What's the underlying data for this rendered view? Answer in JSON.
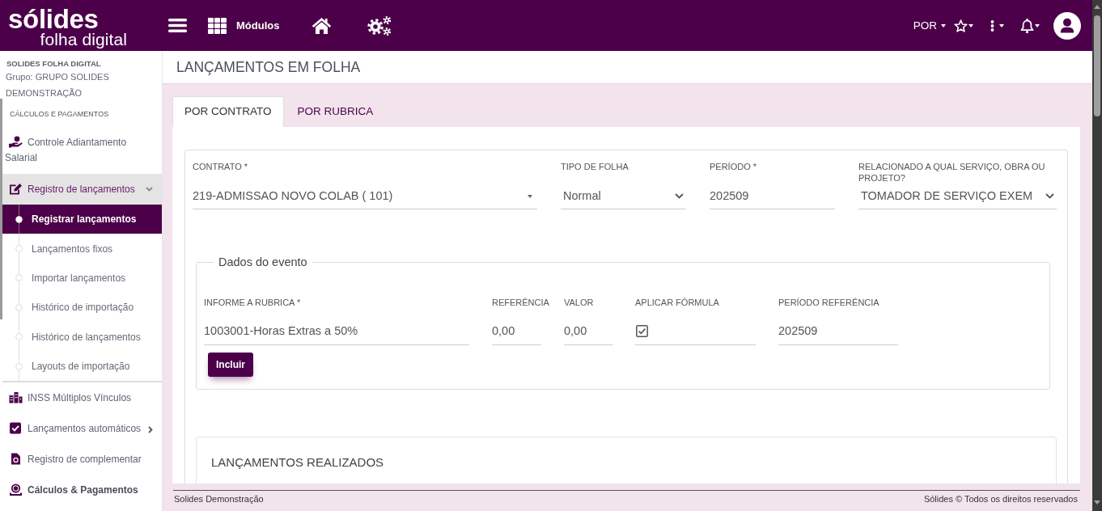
{
  "topbar": {
    "logo": {
      "wordmark": "sólides",
      "tagline": "folha digital"
    },
    "modules_label": "Módulos",
    "language": "POR"
  },
  "sidebar": {
    "company": "SOLIDES FOLHA DIGITAL",
    "group": "Grupo: GRUPO SOLIDES DEMONSTRAÇÃO",
    "section": "CÁLCULOS E PAGAMENTOS",
    "items": [
      {
        "label": "Controle Adiantamento Salarial",
        "kind": "link",
        "selected": false
      },
      {
        "label": "Registro de lançamentos",
        "kind": "group",
        "selected": false,
        "expanded": true,
        "children": [
          {
            "label": "Registrar lançamentos",
            "selected": true
          },
          {
            "label": "Lançamentos fixos",
            "selected": false
          },
          {
            "label": "Importar lançamentos",
            "selected": false
          },
          {
            "label": "Histórico de importação",
            "selected": false
          },
          {
            "label": "Histórico de lançamentos",
            "selected": false
          },
          {
            "label": "Layouts de importação",
            "selected": false
          }
        ]
      },
      {
        "label": "INSS Múltiplos Vínculos",
        "kind": "link",
        "selected": false
      },
      {
        "label": "Lançamentos automáticos",
        "kind": "group",
        "selected": false,
        "expanded": false
      },
      {
        "label": "Registro de complementar",
        "kind": "link",
        "selected": false
      },
      {
        "label": "Cálculos & Pagamentos",
        "kind": "heading",
        "selected": false
      }
    ]
  },
  "page": {
    "title": "LANÇAMENTOS EM FOLHA"
  },
  "tabs": [
    {
      "label": "POR CONTRATO",
      "selected": true
    },
    {
      "label": "POR RUBRICA",
      "selected": false
    }
  ],
  "form": {
    "fields": [
      {
        "label": "CONTRATO *",
        "kind": "combo",
        "value": "219-ADMISSAO NOVO COLAB ( 101)"
      },
      {
        "label": "TIPO DE FOLHA",
        "kind": "select",
        "value": "Normal"
      },
      {
        "label": "PERÍODO *",
        "kind": "text",
        "value": "202509"
      },
      {
        "label": "RELACIONADO A QUAL SERVIÇO, OBRA OU PROJETO?",
        "kind": "select",
        "value": "TOMADOR DE SERVIÇO EXEM"
      }
    ]
  },
  "event": {
    "legend": "Dados do evento",
    "fields": [
      {
        "label": "INFORME A RUBRICA *",
        "kind": "text",
        "value": "1003001-Horas Extras a 50%"
      },
      {
        "label": "REFERÊNCIA",
        "kind": "text",
        "value": "0,00"
      },
      {
        "label": "VALOR",
        "kind": "text",
        "value": "0,00"
      },
      {
        "label": "APLICAR FÓRMULA",
        "kind": "checkbox",
        "checked": true
      },
      {
        "label": "PERÍODO REFERÊNCIA",
        "kind": "text",
        "value": "202509"
      }
    ],
    "button": "Incluir"
  },
  "results": {
    "title": "LANÇAMENTOS REALIZADOS"
  },
  "footer": {
    "left": "Solides Demonstração",
    "right": "Sólides © Todos os direitos reservados"
  }
}
